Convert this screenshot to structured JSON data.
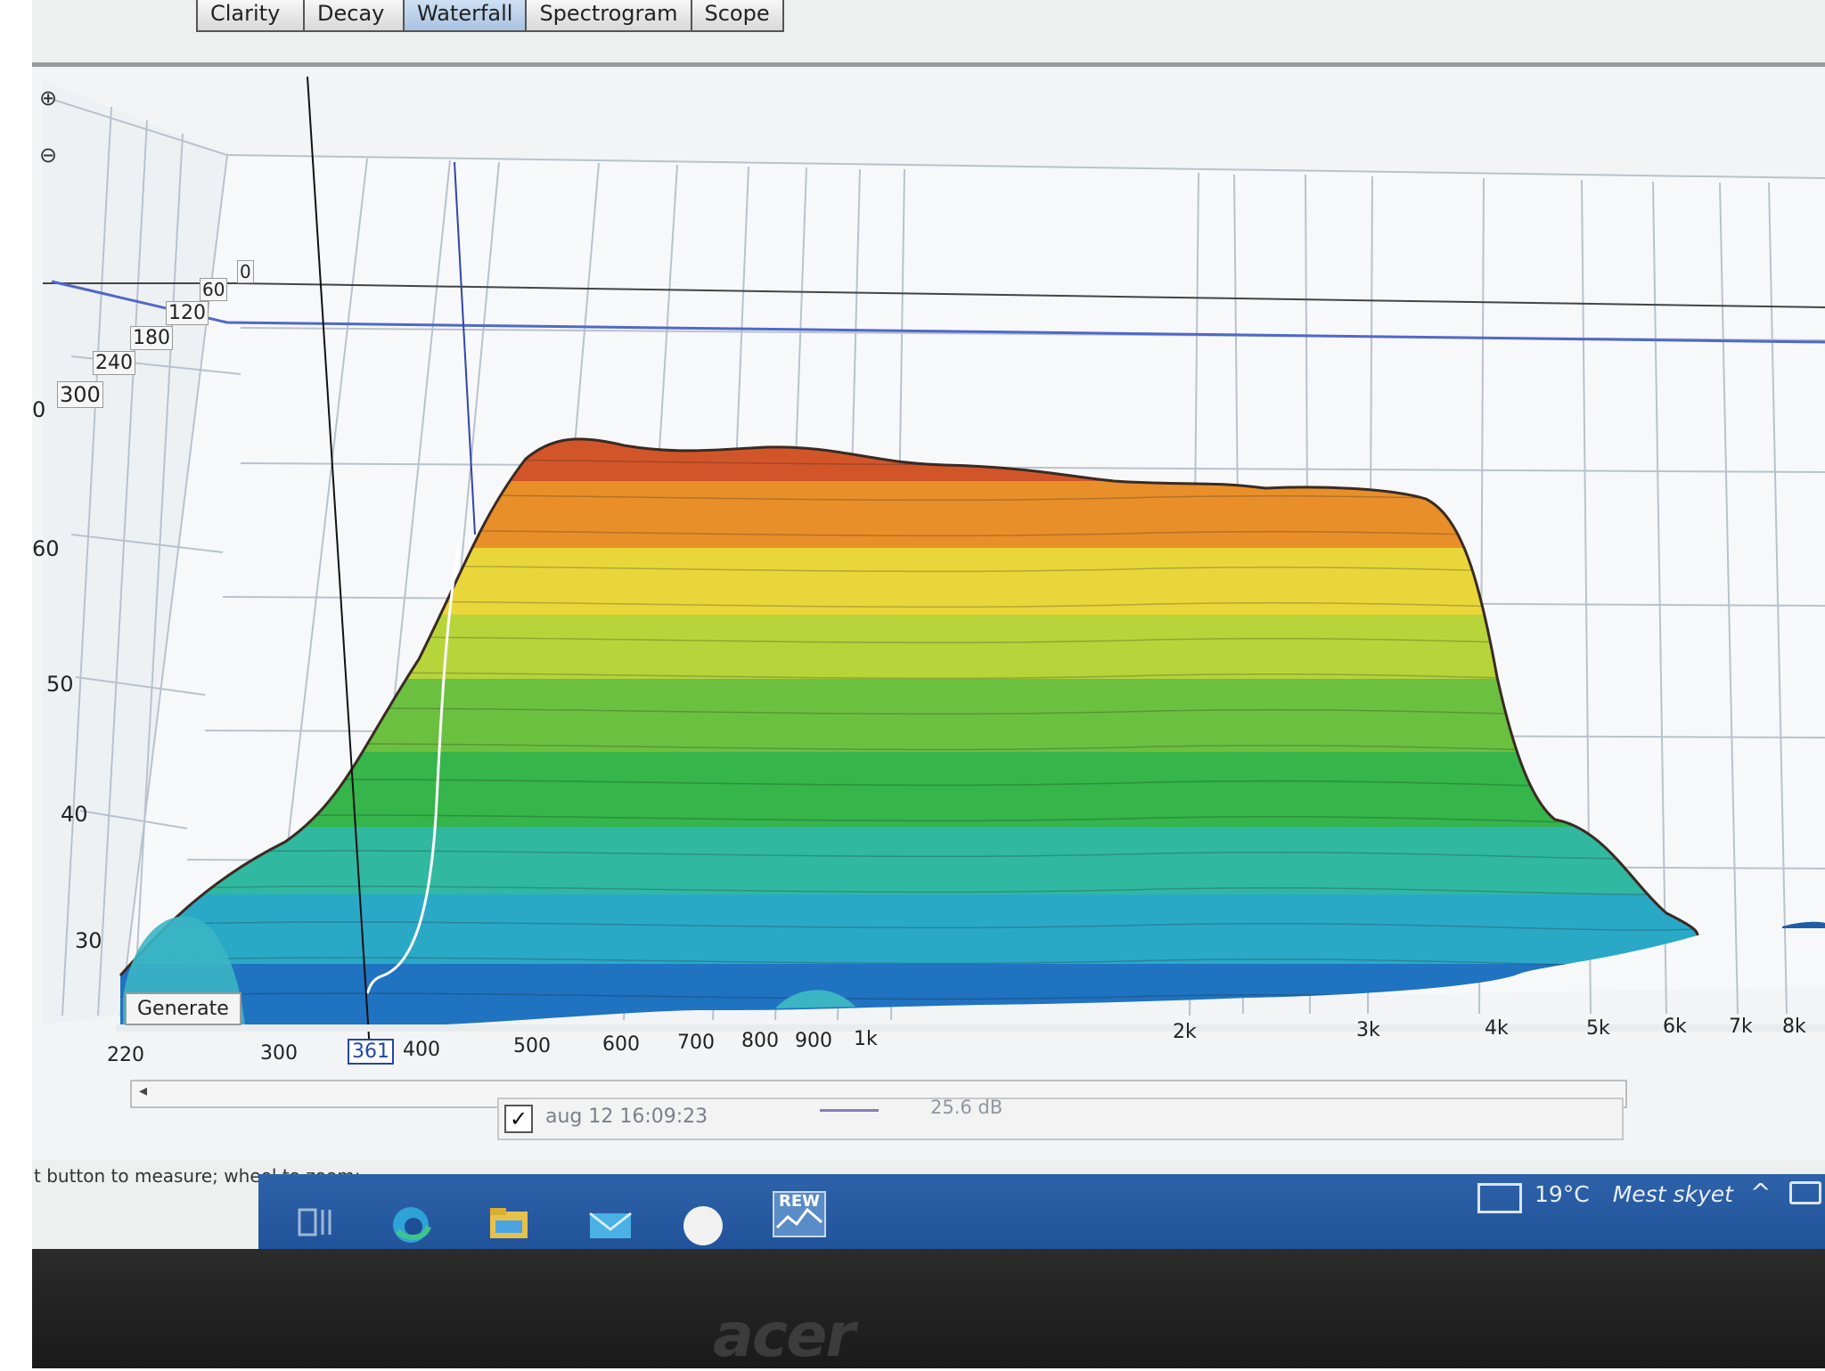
{
  "tabs": [
    "Waterfall",
    "Spectrogram",
    "Scope"
  ],
  "partial_tabs": [
    "Clarity",
    "Decay"
  ],
  "active_tab": "Waterfall",
  "y_axis": {
    "ticks": [
      "60",
      "50",
      "40",
      "30"
    ],
    "top_partial": "0"
  },
  "depth_axis": {
    "ticks": [
      "0",
      "60",
      "120",
      "180",
      "240",
      "300"
    ]
  },
  "x_axis": {
    "ticks": [
      "220",
      "300",
      "400",
      "500",
      "600",
      "700",
      "800",
      "900",
      "1k",
      "2k",
      "3k",
      "4k",
      "5k",
      "6k",
      "7k",
      "8k"
    ],
    "cursor_value": "361"
  },
  "generate_button": "Generate",
  "legend": {
    "checked": true,
    "checkmark": "✓",
    "name": "aug 12 16:09:23",
    "value": "25.6 dB"
  },
  "status_text": "t button to measure; wheel to zoom;",
  "taskbar": {
    "apps": [
      "task-view",
      "edge",
      "file-explorer",
      "mail",
      "circle-app",
      "rew"
    ],
    "rew_label": "REW",
    "weather_temp": "19°C",
    "weather_desc": "Mest skyet",
    "chevron": "^"
  },
  "brand": "acer",
  "colors": {
    "bands": [
      "#d2552a",
      "#e88f2a",
      "#e9d63a",
      "#b8d43b",
      "#6cc040",
      "#35b54a",
      "#30b8a0",
      "#2aa9c7",
      "#1f73c1"
    ]
  }
}
